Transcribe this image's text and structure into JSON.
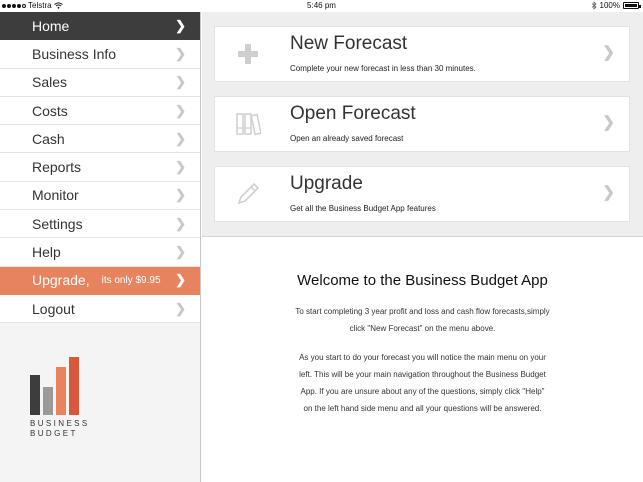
{
  "status_bar": {
    "carrier": "Telstra",
    "time": "5:46 pm",
    "battery": "100%",
    "battery_level": 1.0
  },
  "sidebar": {
    "items": [
      {
        "label": "Home",
        "state": "active"
      },
      {
        "label": "Business Info"
      },
      {
        "label": "Sales"
      },
      {
        "label": "Costs"
      },
      {
        "label": "Cash"
      },
      {
        "label": "Reports"
      },
      {
        "label": "Monitor"
      },
      {
        "label": "Settings"
      },
      {
        "label": "Help"
      },
      {
        "label": "Upgrade,",
        "sub": "its only $9.95",
        "state": "highlight"
      },
      {
        "label": "Logout"
      }
    ],
    "logo": {
      "line1": "BUSINESS",
      "line2": "BUDGET",
      "bar_colors": [
        "#3d3d3d",
        "#9a9a9a",
        "#e8835f",
        "#d9583a"
      ]
    }
  },
  "cards": [
    {
      "icon": "plus-icon",
      "title": "New Forecast",
      "desc": "Complete your new forecast in less than 30 minutes."
    },
    {
      "icon": "binders-icon",
      "title": "Open Forecast",
      "desc": "Open an already saved forecast"
    },
    {
      "icon": "pen-icon",
      "title": "Upgrade",
      "desc": "Get all the Business Budget App features"
    }
  ],
  "welcome": {
    "title": "Welcome to the Business Budget App",
    "p1": "To start completing 3 year profit and loss and cash flow forecasts,simply click \"New Forecast\" on the menu above.",
    "p2": "As you start to do your forecast you will notice the main menu on your left. This will be your main navigation throughout the Business Budget App. If you are unsure about any of the questions, simply click \"Help\" on the left hand side menu and all your questions will be answered."
  },
  "colors": {
    "accent": "#e8835f",
    "active": "#3d3d3d"
  }
}
